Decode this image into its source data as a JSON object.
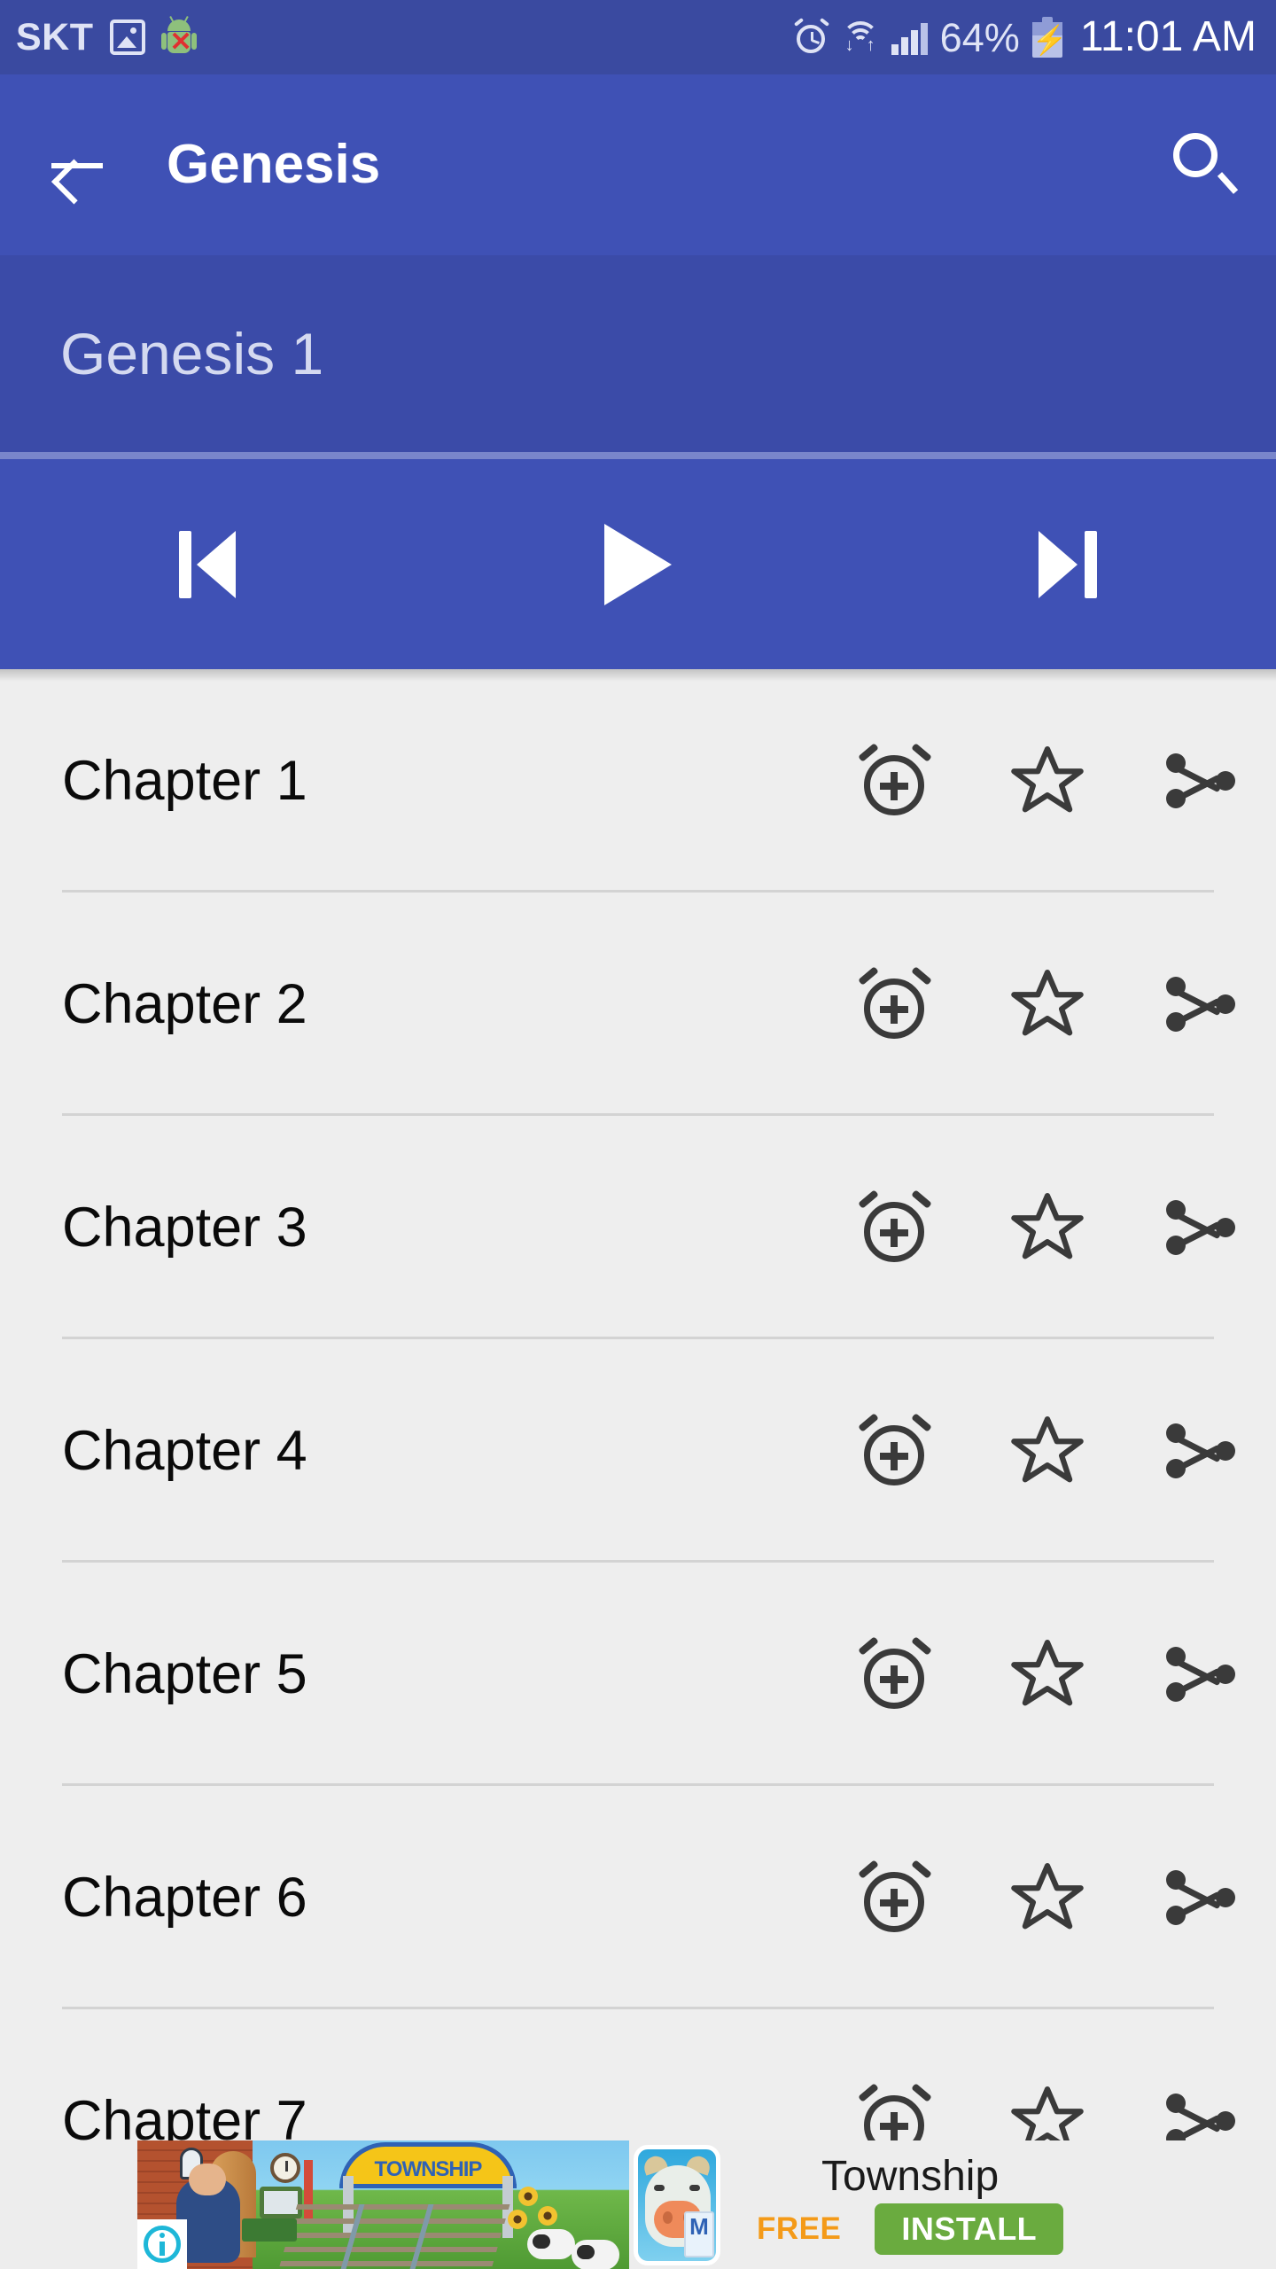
{
  "status_bar": {
    "carrier": "SKT",
    "battery_percent": "64%",
    "time": "11:01 AM",
    "icons": {
      "screenshot": "image-icon",
      "android": "android-robot-x-icon",
      "alarm": "alarm-icon",
      "wifi": "wifi-icon",
      "signal": "signal-bars-icon",
      "battery": "battery-charging-icon"
    },
    "signal_bars_active": 3
  },
  "app_bar": {
    "back_label": "back-arrow",
    "title": "Genesis",
    "search_label": "search-icon"
  },
  "subtitle_band": {
    "text": "Genesis 1"
  },
  "player": {
    "previous_label": "previous-track",
    "play_label": "play",
    "next_label": "next-track"
  },
  "list": {
    "action_labels": {
      "alarm": "Set alarm",
      "favorite": "Add to favorites",
      "share": "Share"
    },
    "rows": [
      {
        "label": "Chapter 1"
      },
      {
        "label": "Chapter 2"
      },
      {
        "label": "Chapter 3"
      },
      {
        "label": "Chapter 4"
      },
      {
        "label": "Chapter 5"
      },
      {
        "label": "Chapter 6"
      },
      {
        "label": "Chapter 7"
      }
    ]
  },
  "ad": {
    "title": "Township",
    "price": "FREE",
    "install_label": "INSTALL",
    "arch_text": "TOWNSHIP",
    "app_icon_letter": "M",
    "info_label": "ad-info"
  },
  "colors": {
    "status_bar": "#3a4aa0",
    "app_bar": "#3f51b5",
    "subtitle_band": "#3b4ba8",
    "player_divider": "#7986cb",
    "list_bg": "#eeeeee",
    "divider": "#d3d3d3",
    "install_button": "#6aab3f",
    "free_text": "#f49a18",
    "info_icon": "#1eb7d8"
  }
}
